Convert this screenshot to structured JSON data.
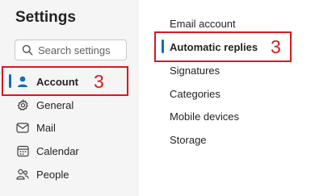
{
  "settings": {
    "title": "Settings",
    "search_placeholder": "Search settings"
  },
  "nav": {
    "items": [
      {
        "label": "Account",
        "icon": "person-icon",
        "selected": true
      },
      {
        "label": "General",
        "icon": "gear-icon"
      },
      {
        "label": "Mail",
        "icon": "mail-icon"
      },
      {
        "label": "Calendar",
        "icon": "calendar-icon"
      },
      {
        "label": "People",
        "icon": "people-icon"
      }
    ]
  },
  "account_sub": {
    "items": [
      {
        "label": "Email account"
      },
      {
        "label": "Automatic replies",
        "selected": true
      },
      {
        "label": "Signatures"
      },
      {
        "label": "Categories"
      },
      {
        "label": "Mobile devices"
      },
      {
        "label": "Storage"
      }
    ]
  },
  "annotations": {
    "account_step": "3",
    "auto_replies_step": "3",
    "color": "#d7191c"
  },
  "colors": {
    "accent": "#0f6cbd",
    "left_pane_bg": "#f5f5f5"
  }
}
